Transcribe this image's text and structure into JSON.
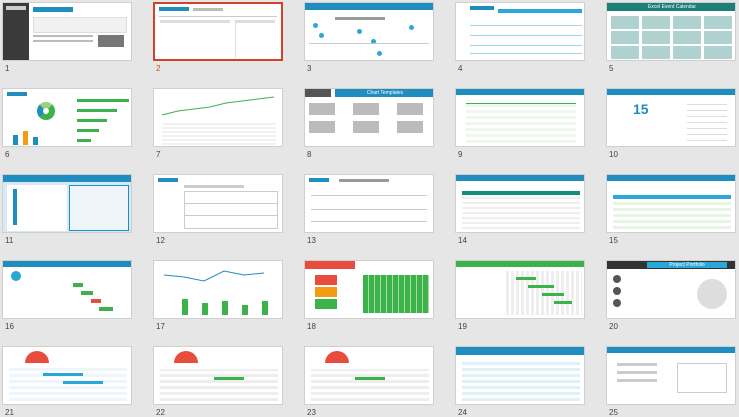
{
  "slides": [
    {
      "n": "1"
    },
    {
      "n": "2",
      "selected": true
    },
    {
      "n": "3"
    },
    {
      "n": "4"
    },
    {
      "n": "5"
    },
    {
      "n": "6"
    },
    {
      "n": "7"
    },
    {
      "n": "8"
    },
    {
      "n": "9"
    },
    {
      "n": "10"
    },
    {
      "n": "11"
    },
    {
      "n": "12"
    },
    {
      "n": "13"
    },
    {
      "n": "14"
    },
    {
      "n": "15"
    },
    {
      "n": "16"
    },
    {
      "n": "17"
    },
    {
      "n": "18"
    },
    {
      "n": "19"
    },
    {
      "n": "20"
    },
    {
      "n": "21"
    },
    {
      "n": "22"
    },
    {
      "n": "23"
    },
    {
      "n": "24"
    },
    {
      "n": "25"
    }
  ],
  "thumb_titles": {
    "t5": "Excel Event Calendar",
    "t8": "Chart Templates",
    "t15": "",
    "t20": "Project Portfolio",
    "t10_big": "15"
  },
  "colors": {
    "selected": "#d0432b",
    "accent": "#1f8dbe",
    "green": "#3bb24a"
  }
}
